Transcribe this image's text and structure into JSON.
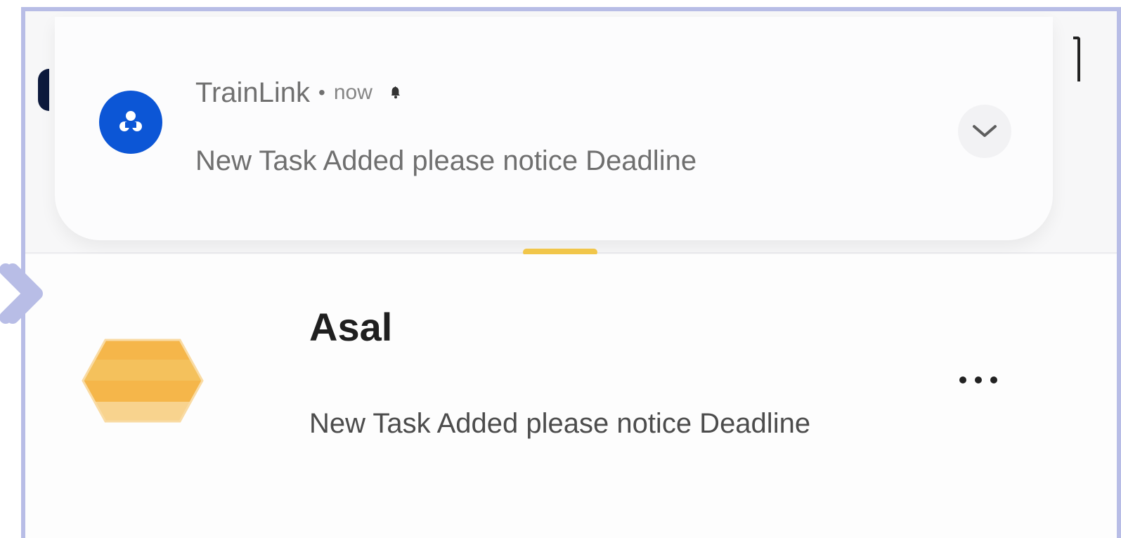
{
  "notification": {
    "app_name": "TrainLink",
    "separator": "•",
    "time": "now",
    "message": "New Task Added please notice Deadline",
    "status_icon": "bell-icon",
    "expand_icon": "chevron-down-icon"
  },
  "list_item": {
    "title": "Asal",
    "message": "New Task Added please notice Deadline",
    "more_icon": "more-horizontal-icon"
  },
  "side": {
    "arrow_icon": "chevron-right-icon"
  },
  "colors": {
    "frame_border": "#b8bde6",
    "app_icon_bg": "#0c56d6",
    "handle_accent": "#f1c64a",
    "hex_accent": "#f4b23f"
  }
}
